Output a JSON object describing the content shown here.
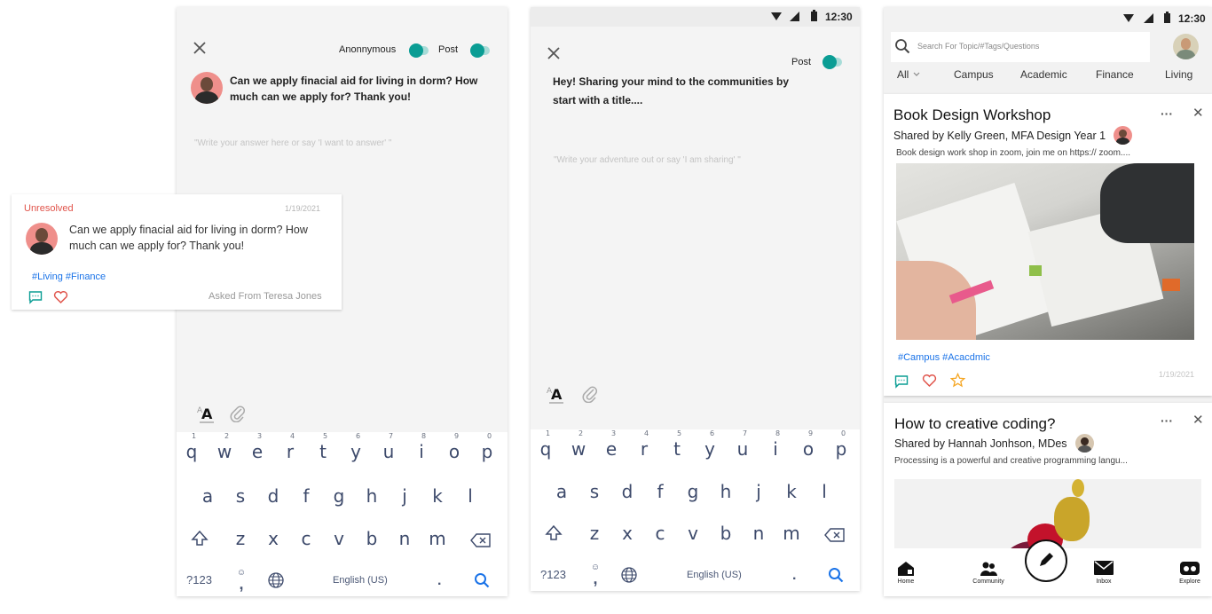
{
  "answer_screen": {
    "anonymous_label": "Anonnymous",
    "post_label": "Post",
    "question": "Can we apply finacial aid for living in dorm? How much can we apply for? Thank you!",
    "placeholder": "\"Write your answer here or say 'I want to answer' \""
  },
  "question_card": {
    "status": "Unresolved",
    "date": "1/19/2021",
    "question": "Can we apply finacial aid for living in dorm? How much can we apply for? Thank you!",
    "tags": "#Living #Finance",
    "asked_from": "Asked From Teresa Jones"
  },
  "share_screen": {
    "status_time": "12:30",
    "post_label": "Post",
    "title_prompt": "Hey! Sharing your mind to the communities by start with a title....",
    "placeholder": "\"Write your adventure out or say 'I am sharing' \""
  },
  "keyboard": {
    "row1": [
      "q",
      "w",
      "e",
      "r",
      "t",
      "y",
      "u",
      "i",
      "o",
      "p"
    ],
    "row1_nums": [
      "1",
      "2",
      "3",
      "4",
      "5",
      "6",
      "7",
      "8",
      "9",
      "0"
    ],
    "row2": [
      "a",
      "s",
      "d",
      "f",
      "g",
      "h",
      "j",
      "k",
      "l"
    ],
    "row3": [
      "z",
      "x",
      "c",
      "v",
      "b",
      "n",
      "m"
    ],
    "sym_label": "?123",
    "emoji_glyph": "☺",
    "comma": ",",
    "space_label": "English (US)",
    "period": "."
  },
  "feed_screen": {
    "status_time": "12:30",
    "search_placeholder": "Search For Topic/#Tags/Questions",
    "tabs": [
      "All",
      "Campus",
      "Academic",
      "Finance",
      "Living"
    ],
    "posts": [
      {
        "title": "Book Design Workshop",
        "shared_by": "Shared by Kelly Green, MFA Design Year 1",
        "excerpt": "Book design work shop in zoom, join me on https:// zoom....",
        "tags": "#Campus #Acacdmic",
        "date": "1/19/2021"
      },
      {
        "title": "How to creative coding?",
        "shared_by": "Shared by Hannah Jonhson, MDes",
        "excerpt": "Processing is a powerful and creative programming langu..."
      }
    ],
    "more_glyph": "···",
    "close_glyph": "✕",
    "nav": [
      "Home",
      "Community",
      "Inbox",
      "Explore"
    ]
  },
  "colors": {
    "accent_teal": "#0a9d94",
    "link_blue": "#1a73e8",
    "unresolved_red": "#e0534a",
    "heart": "#e0534a",
    "star": "#f5a623"
  }
}
